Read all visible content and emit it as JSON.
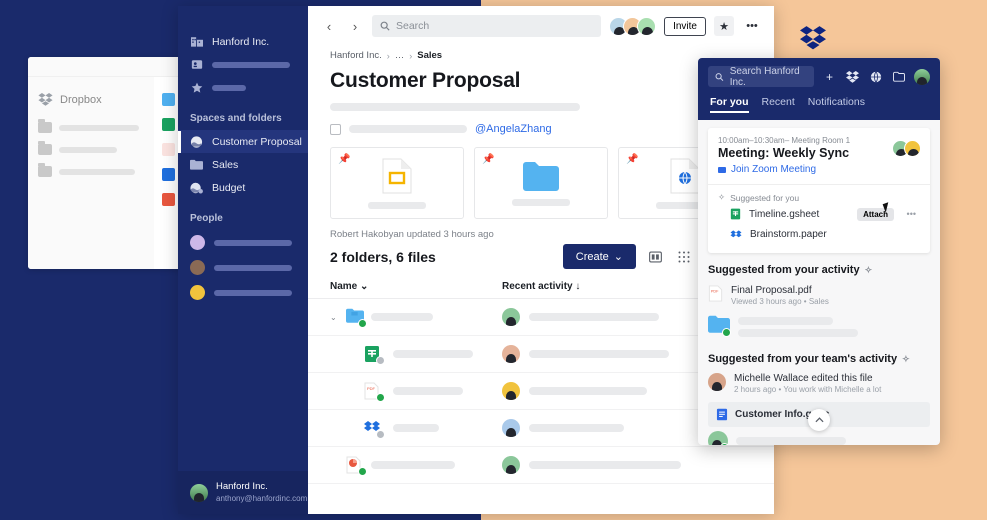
{
  "theme": {
    "brand_blue": "#1a2a6b",
    "accent_orange": "#f5c699",
    "link_blue": "#2e6ae6",
    "sync_green": "#22a64b"
  },
  "background_card": {
    "brand_label": "Dropbox",
    "brand_icon": "dropbox-logo-icon",
    "folder_rows": [
      {
        "icon": "folder-icon"
      },
      {
        "icon": "folder-icon"
      },
      {
        "icon": "folder-icon"
      }
    ],
    "file_rows": [
      {
        "icon": "folder-blue-icon",
        "color": "#4fb0f0"
      },
      {
        "icon": "gsheet-icon",
        "color": "#1aa260"
      },
      {
        "icon": "pdf-icon",
        "color": "#f4b9b0"
      },
      {
        "icon": "paper-icon",
        "color": "#1f6fde"
      },
      {
        "icon": "ppt-icon",
        "color": "#e8573f"
      }
    ]
  },
  "sidebar": {
    "workspace": {
      "label": "Hanford Inc.",
      "icon": "building-icon"
    },
    "nav_items": [
      {
        "icon": "team-icon",
        "label": ""
      },
      {
        "icon": "star-icon",
        "label": ""
      }
    ],
    "spaces_header": "Spaces and folders",
    "spaces": [
      {
        "label": "Customer Proposal",
        "icon": "space-icon",
        "active": true
      },
      {
        "label": "Sales",
        "icon": "folder-icon",
        "active": false
      },
      {
        "label": "Budget",
        "icon": "space-shared-icon",
        "active": false
      }
    ],
    "people_header": "People",
    "people": [
      {
        "icon": "avatar",
        "color": "#cdb7e8"
      },
      {
        "icon": "avatar",
        "color": "#d7b59a"
      },
      {
        "icon": "avatar",
        "color": "#f1c33d"
      }
    ],
    "account": {
      "name": "Hanford Inc.",
      "email": "anthony@hanfordinc.com",
      "avatar": "account-avatar"
    }
  },
  "topbar": {
    "back_icon": "chevron-left-icon",
    "forward_icon": "chevron-right-icon",
    "search_icon": "search-icon",
    "search_placeholder": "Search",
    "search_value": "",
    "members": [
      {
        "color": "#b9d6e8"
      },
      {
        "color": "#f2c69a"
      },
      {
        "color": "#a9dfb0"
      }
    ],
    "invite_label": "Invite",
    "star_icon": "star-icon",
    "more_icon": "ellipsis-icon"
  },
  "breadcrumb": {
    "items": [
      "Hanford Inc.",
      "…",
      "Sales"
    ],
    "separator": "›"
  },
  "main": {
    "title": "Customer Proposal",
    "description_placeholder": true,
    "task": {
      "checkbox": false,
      "mention": "@AngelaZhang"
    },
    "pinned_cards": [
      {
        "pin_icon": "pin-icon",
        "file_icon": "gslides-icon"
      },
      {
        "pin_icon": "pin-icon",
        "file_icon": "folder-blue-icon"
      },
      {
        "pin_icon": "pin-icon",
        "file_icon": "paper-web-icon"
      }
    ],
    "updated_text": "Robert Hakobyan updated 3 hours ago",
    "file_count": "2 folders, 6 files",
    "create_label": "Create",
    "create_caret": "⌄",
    "view_buttons": [
      {
        "icon": "card-view-icon",
        "active": false
      },
      {
        "icon": "fine-grid-view-icon",
        "active": false
      },
      {
        "icon": "grid-view-icon",
        "active": false
      },
      {
        "icon": "list-view-icon",
        "active": true
      }
    ],
    "table": {
      "columns": [
        {
          "label": "Name",
          "sort_icon": "⌄"
        },
        {
          "label": "Recent activity",
          "sort_icon": "↓"
        }
      ],
      "rows": [
        {
          "icon": "folder-shared-icon",
          "color": "#4fb0f0",
          "badge": "ok",
          "expandable": true,
          "name_width": 62,
          "activity_width": 130,
          "avatar_color": "#8bc79a"
        },
        {
          "icon": "gsheet-icon",
          "color": "#1aa260",
          "badge": "sync",
          "expandable": false,
          "name_width": 80,
          "activity_width": 140,
          "avatar_color": "#e5b39a"
        },
        {
          "icon": "pdf-icon",
          "color": "#f4b9b0",
          "badge": "ok",
          "expandable": false,
          "name_width": 70,
          "activity_width": 118,
          "avatar_color": "#f1c33d"
        },
        {
          "icon": "paper-icon",
          "color": "#1f6fde",
          "badge": "sync",
          "expandable": false,
          "name_width": 46,
          "activity_width": 95,
          "avatar_color": "#a9c9ea"
        },
        {
          "icon": "ppt-icon",
          "color": "#e8573f",
          "badge": "ok",
          "expandable": false,
          "name_width": 84,
          "activity_width": 152,
          "avatar_color": "#8bc79a"
        }
      ]
    }
  },
  "panel": {
    "search_icon": "search-icon",
    "search_placeholder": "Search Hanford Inc.",
    "search_value": "",
    "actions": [
      {
        "icon": "plus-icon"
      },
      {
        "icon": "dropbox-icon"
      },
      {
        "icon": "globe-icon"
      },
      {
        "icon": "folder-icon"
      }
    ],
    "avatar": "user-avatar",
    "tabs": [
      {
        "label": "For you",
        "active": true
      },
      {
        "label": "Recent",
        "active": false
      },
      {
        "label": "Notifications",
        "active": false
      }
    ],
    "meeting": {
      "time": "10:00am–10:30am– Meeting Room 1",
      "title": "Meeting: Weekly Sync",
      "link_label": "Join Zoom Meeting",
      "link_icon": "zoom-icon",
      "attendees": [
        {
          "color": "#8bc79a"
        },
        {
          "color": "#f1c33d"
        }
      ]
    },
    "suggested": {
      "header": "Suggested for you",
      "header_icon": "sparkle-icon",
      "items": [
        {
          "name": "Timeline.gsheet",
          "icon": "gsheet-icon",
          "color": "#1aa260",
          "attach_label": "Attach",
          "more_icon": "ellipsis-icon",
          "show_attach": true
        },
        {
          "name": "Brainstorm.paper",
          "icon": "paper-icon",
          "color": "#1f6fde",
          "attach_label": "",
          "more_icon": "",
          "show_attach": false
        }
      ]
    },
    "activity_section": {
      "header": "Suggested from your activity",
      "header_icon": "sparkle-icon",
      "files": [
        {
          "name": "Final Proposal.pdf",
          "meta": "Viewed 3 hours ago • Sales",
          "icon": "pdf-icon",
          "color": "#f4b9b0"
        }
      ],
      "placeholder_row": {
        "icon": "folder-shared-icon",
        "color": "#4fb0f0",
        "badge": "ok"
      }
    },
    "team_section": {
      "header": "Suggested from your team's activity",
      "header_icon": "sparkle-icon",
      "actor": {
        "text": "Michelle Wallace edited this file",
        "meta": "2 hours ago • You work with Michelle a lot",
        "avatar_color": "#d7a48a"
      },
      "doc": {
        "name": "Customer Info.gdoc",
        "icon": "gdoc-icon",
        "color": "#2e6ae6"
      },
      "footer_avatar_color": "#8bc79a",
      "footer_badge": "ok"
    },
    "collapse_icon": "chevron-up-icon"
  },
  "dropbox_logo": {
    "icon": "dropbox-logo-icon",
    "color": "#0d2481"
  }
}
